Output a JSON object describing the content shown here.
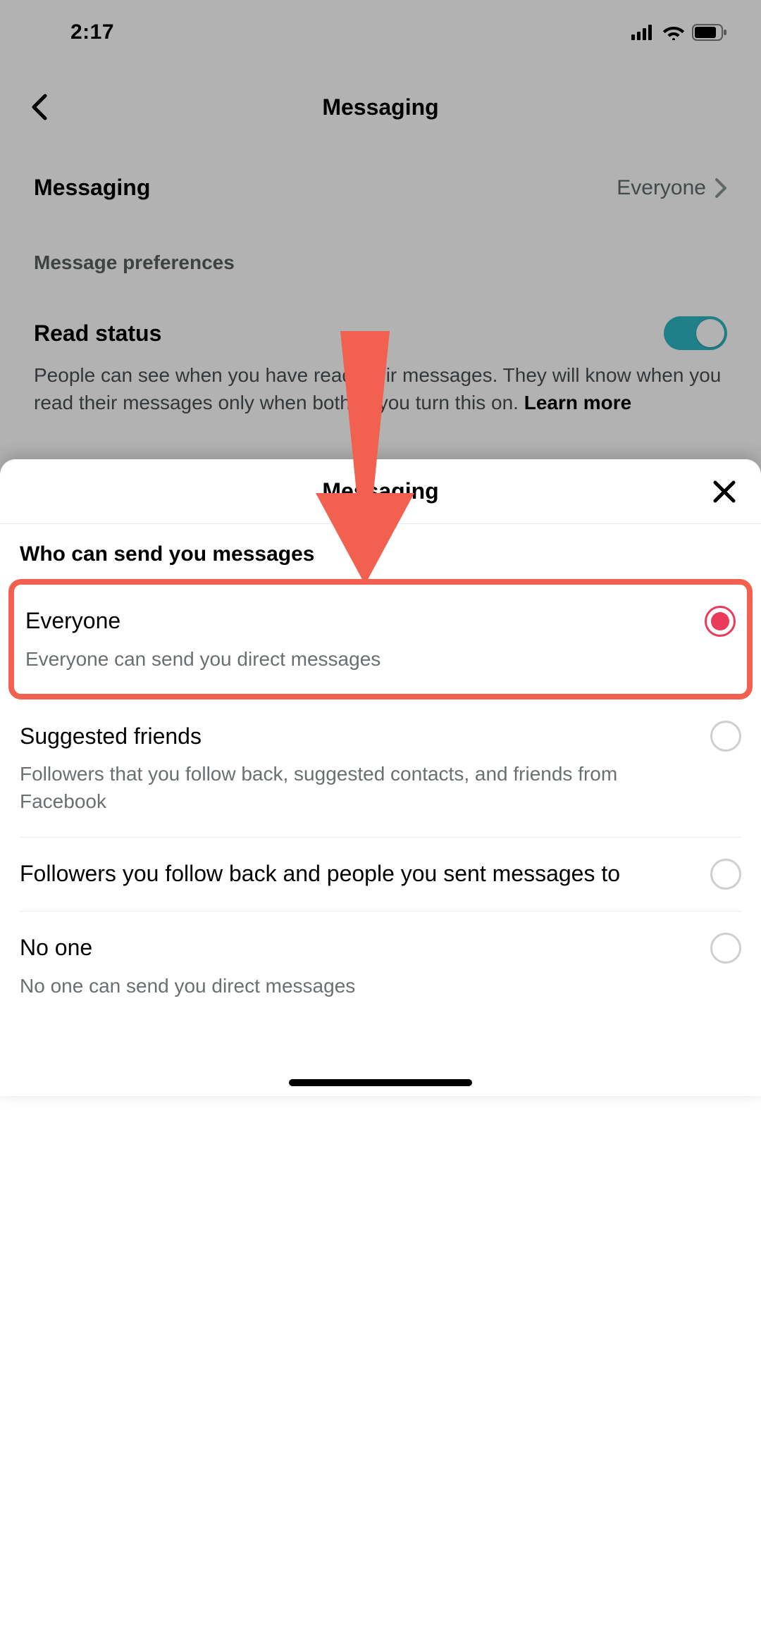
{
  "status": {
    "time": "2:17"
  },
  "nav": {
    "title": "Messaging"
  },
  "settings": {
    "messaging_row": {
      "label": "Messaging",
      "value": "Everyone"
    },
    "preferences_heading": "Message preferences",
    "read_status": {
      "label": "Read status",
      "description_prefix": "People can see when you have read their messages. They will know when you read their messages only when both of you turn this on. ",
      "learn_more": "Learn more",
      "toggle_on": true
    }
  },
  "sheet": {
    "title": "Messaging",
    "subheading": "Who can send you messages",
    "options": [
      {
        "title": "Everyone",
        "description": "Everyone can send you direct messages",
        "selected": true,
        "highlighted": true
      },
      {
        "title": "Suggested friends",
        "description": "Followers that you follow back, suggested contacts, and friends from Facebook",
        "selected": false,
        "highlighted": false
      },
      {
        "title": "Followers you follow back and people you sent messages to",
        "description": "",
        "selected": false,
        "highlighted": false
      },
      {
        "title": "No one",
        "description": "No one can send you direct messages",
        "selected": false,
        "highlighted": false
      }
    ]
  },
  "annotation": {
    "arrow_color": "#f2604f"
  }
}
